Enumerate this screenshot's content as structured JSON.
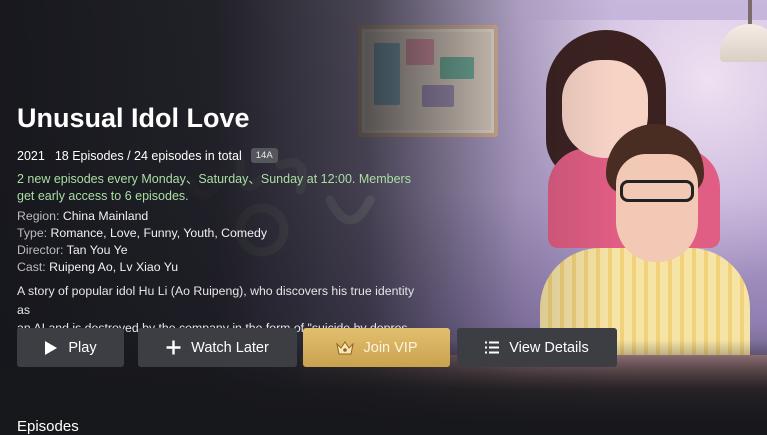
{
  "show": {
    "title": "Unusual Idol Love",
    "year": "2021",
    "episodes_text": "18 Episodes / 24 episodes in total",
    "rating_badge": "14A",
    "schedule": "2 new episodes every Monday、Saturday、Sunday at 12:00. Members get early access to 6 episodes.",
    "region_label": "Region:",
    "region_value": "China Mainland",
    "type_label": "Type:",
    "type_value": "Romance, Love, Funny, Youth, Comedy",
    "director_label": "Director:",
    "director_value": "Tan You Ye",
    "cast_label": "Cast:",
    "cast_value": "Ruipeng Ao, Lv Xiao Yu",
    "synopsis_line1": "A story of popular idol Hu Li (Ao Ruipeng), who discovers his true identity as",
    "synopsis_line2": "an AI and is destroyed by the company in the form of \"suicide by depressio…"
  },
  "buttons": {
    "play": "Play",
    "watch_later": "Watch Later",
    "join_vip": "Join VIP",
    "view_details": "View Details"
  },
  "sections": {
    "episodes": "Episodes"
  },
  "colors": {
    "schedule_text": "#a9dfa3",
    "vip_gold": "#d6b35f",
    "button_bg": "#3d3e44"
  },
  "icons": {
    "play": "play-icon",
    "watch_later": "plus-icon",
    "join_vip": "crown-icon",
    "view_details": "list-icon"
  }
}
